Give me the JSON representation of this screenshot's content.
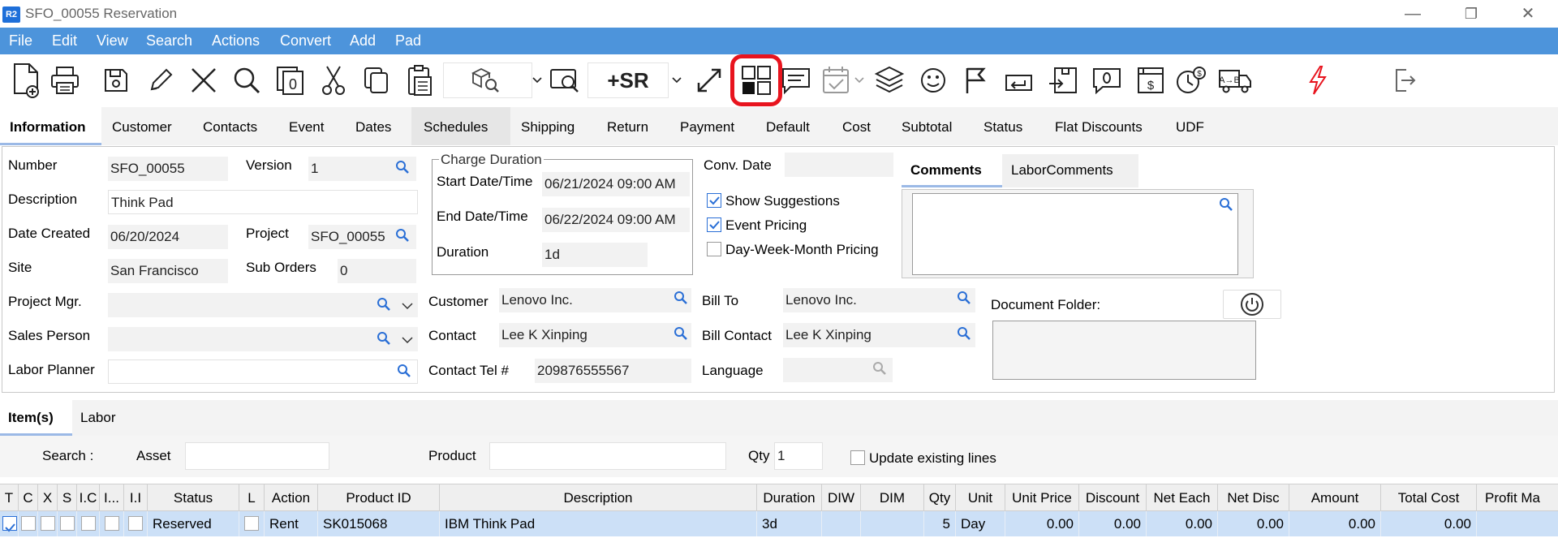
{
  "window": {
    "logo": "R2",
    "title": "SFO_00055 Reservation",
    "minimize": "—",
    "restore": "❐",
    "close": "✕"
  },
  "menu": [
    "File",
    "Edit",
    "View",
    "Search",
    "Actions",
    "Convert",
    "Add",
    "Pad"
  ],
  "toolbar": {
    "new_sr_label": "+SR",
    "icons": [
      "new-document-icon",
      "print-icon",
      "save-icon",
      "edit-pencil-icon",
      "delete-x-icon",
      "search-icon",
      "copy-numbered-icon",
      "cut-icon",
      "copy-icon",
      "paste-clipboard-icon",
      "product-lookup-icon",
      "dropdown-arrow-icon",
      "screen-search-icon",
      "new-sr-button",
      "expand-icon",
      "grid-view-icon",
      "comment-icon",
      "calendar-check-icon",
      "layers-icon",
      "smiley-icon",
      "flag-icon",
      "return-arrow-icon",
      "import-icon",
      "chat-info-icon",
      "browser-dollar-icon",
      "clock-dollar-icon",
      "delivery-truck-icon",
      "lightning-icon",
      "exit-icon"
    ],
    "highlight_color": "#e8141e"
  },
  "tabs": [
    "Information",
    "Customer",
    "Contacts",
    "Event",
    "Dates",
    "Schedules",
    "Shipping",
    "Return",
    "Payment",
    "Default",
    "Cost",
    "Subtotal",
    "Status",
    "Flat Discounts",
    "UDF"
  ],
  "form": {
    "number_label": "Number",
    "number_value": "SFO_00055",
    "version_label": "Version",
    "version_value": "1",
    "description_label": "Description",
    "description_value": "Think Pad",
    "date_created_label": "Date Created",
    "date_created_value": "06/20/2024",
    "project_label": "Project",
    "project_value": "SFO_00055",
    "site_label": "Site",
    "site_value": "San Francisco",
    "sub_orders_label": "Sub Orders",
    "sub_orders_value": "0",
    "project_mgr_label": "Project Mgr.",
    "project_mgr_value": "",
    "sales_person_label": "Sales Person",
    "sales_person_value": "",
    "labor_planner_label": "Labor Planner",
    "labor_planner_value": "",
    "charge_duration_title": "Charge Duration",
    "start_label": "Start Date/Time",
    "start_value": "06/21/2024 09:00 AM",
    "end_label": "End Date/Time",
    "end_value": "06/22/2024 09:00 AM",
    "duration_label": "Duration",
    "duration_value": "1d",
    "conv_date_label": "Conv. Date",
    "conv_date_value": "",
    "show_suggestions_label": "Show Suggestions",
    "show_suggestions_checked": true,
    "event_pricing_label": "Event Pricing",
    "event_pricing_checked": true,
    "dwm_pricing_label": "Day-Week-Month Pricing",
    "dwm_pricing_checked": false,
    "customer_label": "Customer",
    "customer_value": "Lenovo Inc.",
    "contact_label": "Contact",
    "contact_value": "Lee K Xinping",
    "contact_tel_label": "Contact Tel #",
    "contact_tel_value": "209876555567",
    "bill_to_label": "Bill To",
    "bill_to_value": "Lenovo Inc.",
    "bill_contact_label": "Bill Contact",
    "bill_contact_value": "Lee K Xinping",
    "language_label": "Language",
    "language_value": "",
    "document_folder_label": "Document Folder:",
    "comments_tab": "Comments",
    "labor_comments_tab": "LaborComments"
  },
  "items_tabs": [
    "Item(s)",
    "Labor"
  ],
  "search_row": {
    "search_label": "Search :",
    "asset_label": "Asset",
    "asset_value": "",
    "product_label": "Product",
    "product_value": "",
    "qty_label": "Qty",
    "qty_value": "1",
    "update_existing_label": "Update existing lines"
  },
  "grid": {
    "headers": [
      "T",
      "C",
      "X",
      "S",
      "I.C",
      "I...",
      "I.I",
      "Status",
      "L",
      "Action",
      "Product ID",
      "Description",
      "Duration",
      "DIW",
      "DIM",
      "Qty",
      "Unit",
      "Unit Price",
      "Discount",
      "Net Each",
      "Net Disc",
      "Amount",
      "Total Cost",
      "Profit Ma"
    ],
    "row": {
      "status": "Reserved",
      "action": "Rent",
      "product_id": "SK015068",
      "description": "IBM Think Pad",
      "duration": "3d",
      "qty": "5",
      "unit": "Day",
      "unit_price": "0.00",
      "discount": "0.00",
      "net_each": "0.00",
      "net_disc": "0.00",
      "amount": "0.00",
      "total_cost": "0.00"
    }
  }
}
